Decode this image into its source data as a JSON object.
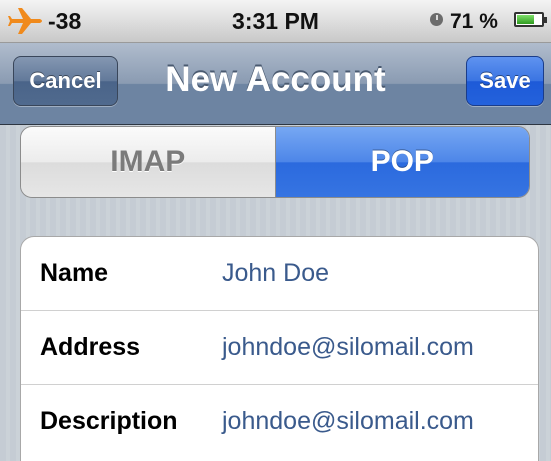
{
  "status_bar": {
    "signal": "-38",
    "time": "3:31 PM",
    "battery_percent": "71 %",
    "battery_level": 0.71,
    "icons": [
      "airplane-icon",
      "clock-icon",
      "battery-icon"
    ],
    "airplane_color": "#f08a1c"
  },
  "nav": {
    "title": "New Account",
    "cancel_label": "Cancel",
    "save_label": "Save"
  },
  "segmented": {
    "options": [
      "IMAP",
      "POP"
    ],
    "selected": "POP"
  },
  "form": {
    "fields": [
      {
        "label": "Name",
        "value": "John Doe"
      },
      {
        "label": "Address",
        "value": "johndoe@silomail.com"
      },
      {
        "label": "Description",
        "value": "johndoe@silomail.com"
      }
    ]
  },
  "colors": {
    "nav_bar": "#6d84a2",
    "save_button": "#1d5ad8",
    "selected_segment": "#2b6ade",
    "field_value": "#3a5a8c"
  }
}
